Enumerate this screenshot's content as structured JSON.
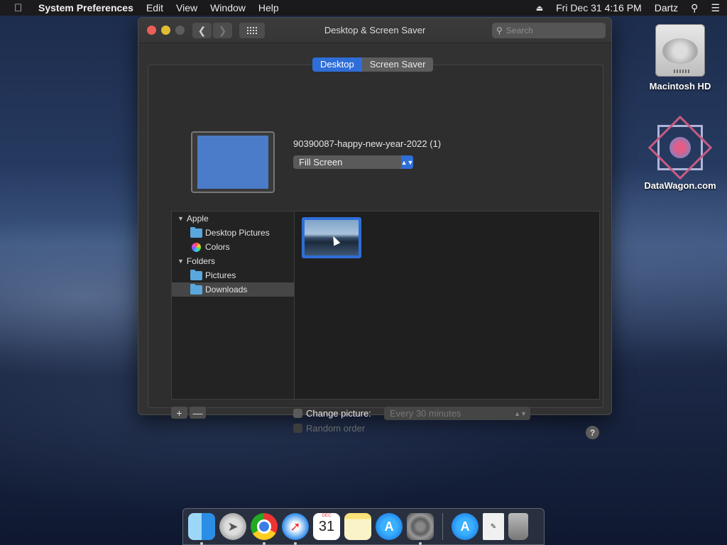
{
  "menubar": {
    "app_name": "System Preferences",
    "menus": [
      "Edit",
      "View",
      "Window",
      "Help"
    ],
    "datetime": "Fri Dec 31  4:16 PM",
    "user": "Dartz"
  },
  "window": {
    "title": "Desktop & Screen Saver",
    "search_placeholder": "Search",
    "tabs": [
      {
        "label": "Desktop",
        "active": true
      },
      {
        "label": "Screen Saver",
        "active": false
      }
    ],
    "current_picture": "90390087-happy-new-year-2022 (1)",
    "fill_mode": "Fill Screen",
    "source_list": {
      "groups": [
        {
          "label": "Apple",
          "items": [
            "Desktop Pictures",
            "Colors"
          ]
        },
        {
          "label": "Folders",
          "items": [
            "Pictures",
            "Downloads"
          ]
        }
      ],
      "selected": "Downloads"
    },
    "add_label": "+",
    "remove_label": "—",
    "change_picture_label": "Change picture:",
    "change_interval": "Every 30 minutes",
    "random_order_label": "Random order",
    "help_label": "?"
  },
  "desktop_icons": [
    {
      "label": "Macintosh HD",
      "icon": "hard-drive-icon"
    },
    {
      "label": "DataWagon.com",
      "icon": "datawagon-icon"
    }
  ],
  "dock": {
    "apps": [
      "finder",
      "launchpad",
      "chrome",
      "safari",
      "calendar",
      "notes",
      "app-store",
      "system-preferences",
      "app-store-download",
      "file",
      "trash"
    ],
    "calendar_month": "DEC",
    "calendar_day": "31"
  },
  "colors": {
    "accent": "#2f6ed8",
    "window_bg": "#323232"
  }
}
